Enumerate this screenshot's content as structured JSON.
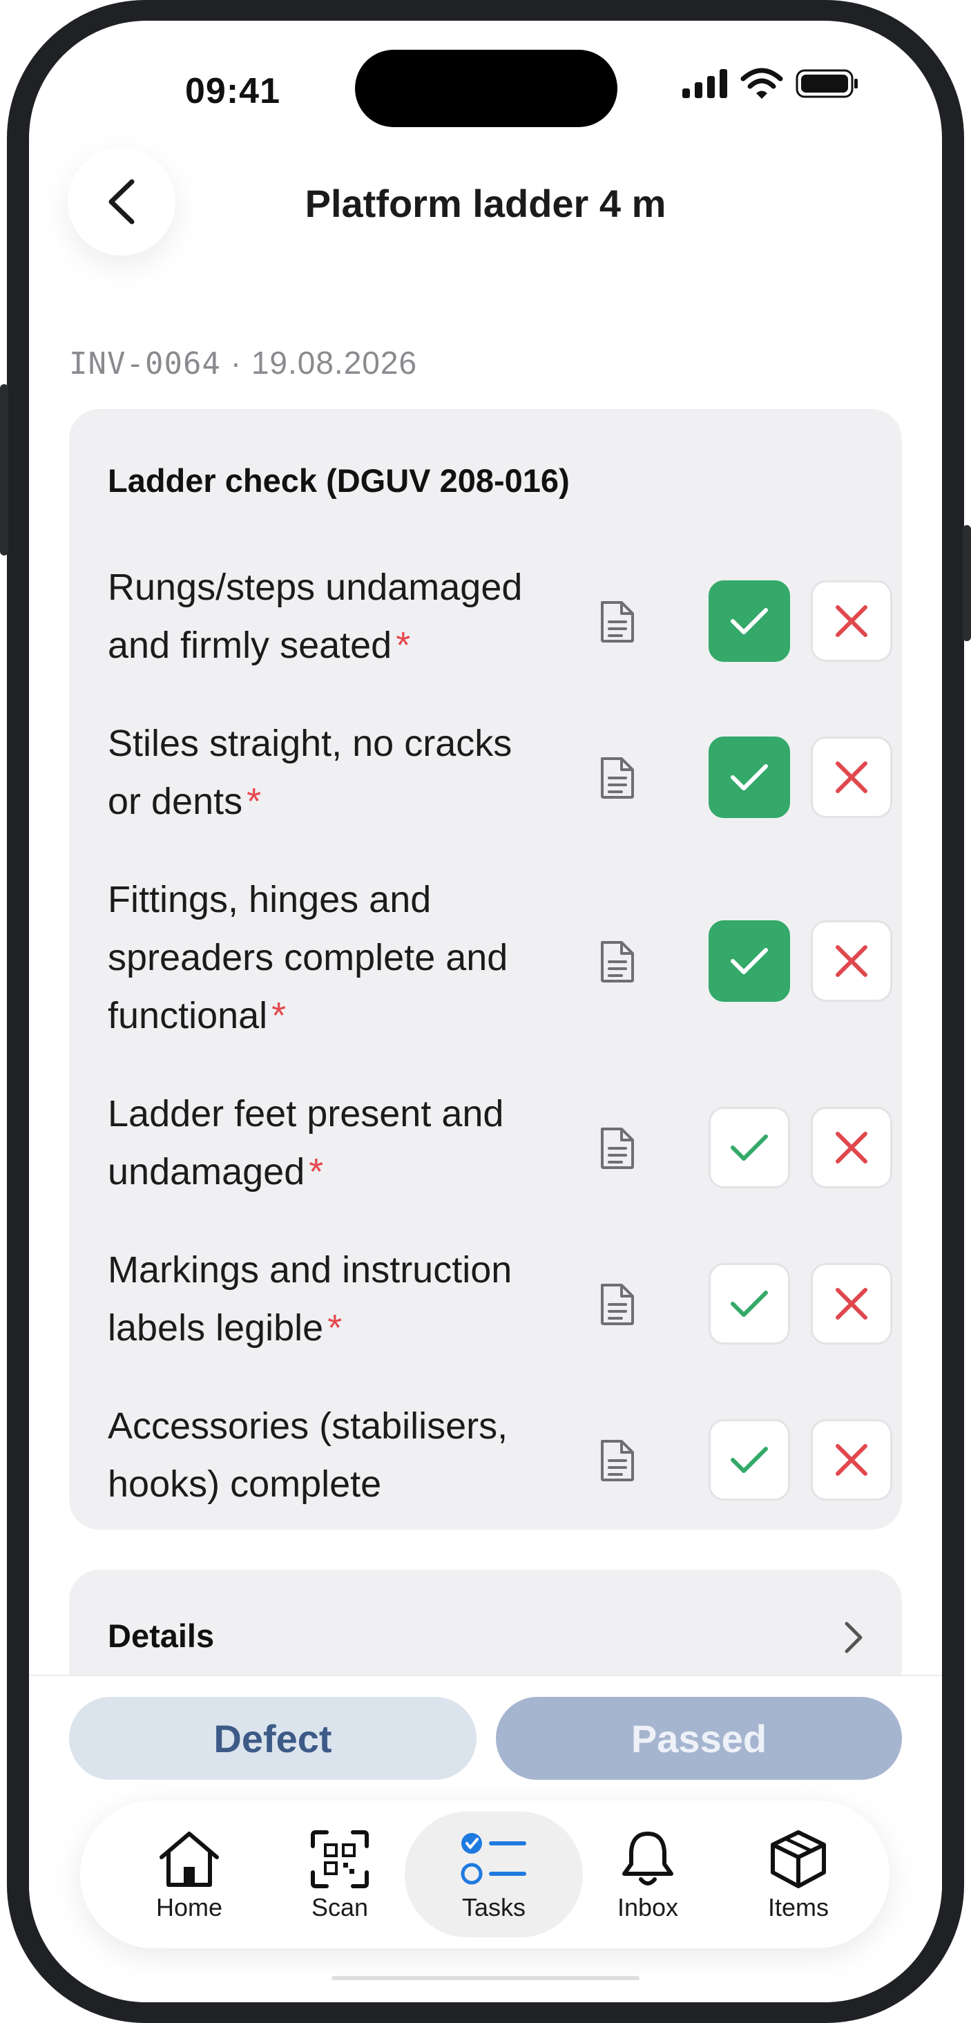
{
  "status_bar": {
    "time": "09:41"
  },
  "header": {
    "title": "Platform ladder 4 m"
  },
  "meta": {
    "inventory_id": "INV-0064",
    "separator": "·",
    "date": "19.08.2026"
  },
  "checklist": {
    "title": "Ladder check (DGUV 208-016)",
    "items": [
      {
        "line1": "Rungs/steps undamaged",
        "line2": "and firmly seated",
        "line3": "",
        "required": "*",
        "status": "passed"
      },
      {
        "line1": "Stiles straight, no cracks",
        "line2": "or dents",
        "line3": "",
        "required": "*",
        "status": "passed"
      },
      {
        "line1": "Fittings, hinges and",
        "line2": "spreaders complete and",
        "line3": "functional",
        "required": "*",
        "status": "passed"
      },
      {
        "line1": "Ladder feet present and",
        "line2": "undamaged",
        "line3": "",
        "required": "*",
        "status": "none"
      },
      {
        "line1": "Markings and instruction",
        "line2": "labels legible",
        "line3": "",
        "required": "*",
        "status": "none"
      },
      {
        "line1": "Accessories (stabilisers,",
        "line2": "hooks) complete",
        "line3": "",
        "required": "",
        "status": "none"
      }
    ]
  },
  "details": {
    "label": "Details"
  },
  "actions": {
    "defect_label": "Defect",
    "passed_label": "Passed"
  },
  "tabbar": {
    "active": "tasks",
    "items": [
      {
        "id": "home",
        "label": "Home",
        "icon": "house-icon"
      },
      {
        "id": "scan",
        "label": "Scan",
        "icon": "qr-code-icon"
      },
      {
        "id": "tasks",
        "label": "Tasks",
        "icon": "task-list-icon"
      },
      {
        "id": "inbox",
        "label": "Inbox",
        "icon": "bell-icon"
      },
      {
        "id": "items",
        "label": "Items",
        "icon": "box-icon"
      }
    ]
  },
  "colors": {
    "pass_green": "#34a96a",
    "fail_red": "#e0484e",
    "required_red": "#e5484d",
    "tab_active_blue": "#1f7ae0",
    "defect_text": "#3d5a87",
    "passed_bg": "#a6b5cf"
  }
}
